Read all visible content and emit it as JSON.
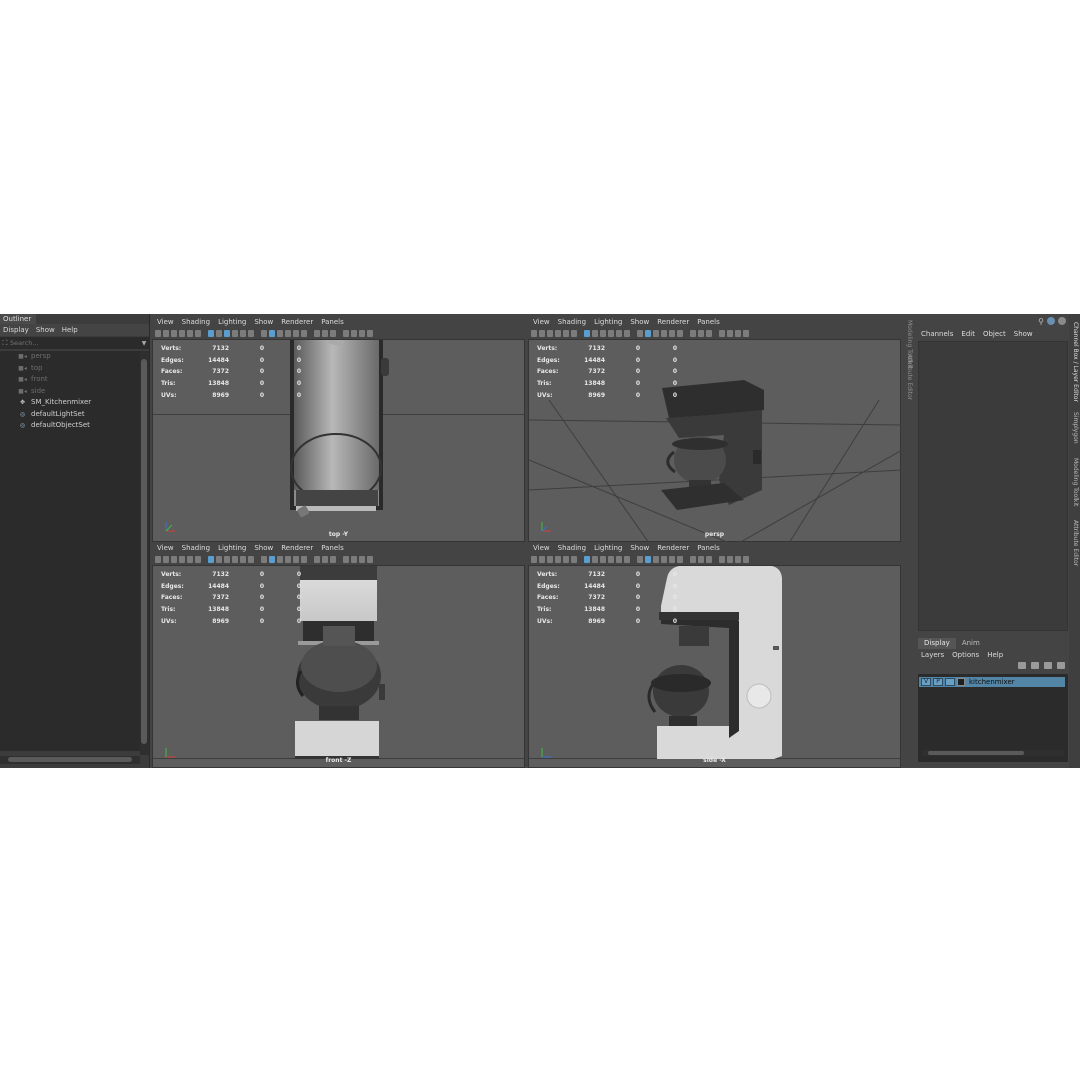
{
  "outliner": {
    "title": "Outliner",
    "menu": [
      "Display",
      "Show",
      "Help"
    ],
    "search_placeholder": "Search...",
    "items": [
      {
        "label": "persp",
        "icon": "camera-icon",
        "dimmed": true
      },
      {
        "label": "top",
        "icon": "camera-icon",
        "dimmed": true
      },
      {
        "label": "front",
        "icon": "camera-icon",
        "dimmed": true
      },
      {
        "label": "side",
        "icon": "camera-icon",
        "dimmed": true
      },
      {
        "label": "SM_Kitchenmixer",
        "icon": "mesh-icon",
        "dimmed": false
      },
      {
        "label": "defaultLightSet",
        "icon": "set-icon",
        "dimmed": false
      },
      {
        "label": "defaultObjectSet",
        "icon": "set-icon",
        "dimmed": false
      }
    ]
  },
  "viewport_menu": [
    "View",
    "Shading",
    "Lighting",
    "Show",
    "Renderer",
    "Panels"
  ],
  "hud": {
    "rows": [
      {
        "label": "Verts:",
        "a": "7132",
        "b": "0",
        "c": "0"
      },
      {
        "label": "Edges:",
        "a": "14484",
        "b": "0",
        "c": "0"
      },
      {
        "label": "Faces:",
        "a": "7372",
        "b": "0",
        "c": "0"
      },
      {
        "label": "Tris:",
        "a": "13848",
        "b": "0",
        "c": "0"
      },
      {
        "label": "UVs:",
        "a": "8969",
        "b": "0",
        "c": "0"
      }
    ]
  },
  "viewports": [
    {
      "label": "top -Y"
    },
    {
      "label": "persp"
    },
    {
      "label": "front -Z"
    },
    {
      "label": "side -X"
    }
  ],
  "side_strip_left": [
    "Modeling Toolkit",
    "Attribute Editor"
  ],
  "side_strip_right": [
    "Channel Box / Layer Editor",
    "Simplygon",
    "Modeling Toolkit",
    "Attribute Editor"
  ],
  "channel_box": {
    "menu": [
      "Channels",
      "Edit",
      "Object",
      "Show"
    ],
    "tabs": [
      "Display",
      "Anim"
    ],
    "layer_menu": [
      "Layers",
      "Options",
      "Help"
    ],
    "layer": {
      "v": "V",
      "p": "P",
      "name": "kitchenmixer"
    }
  },
  "colors": {
    "accent": "#5a9ecf",
    "layer_highlight": "#5285a6",
    "background": "#444444"
  }
}
